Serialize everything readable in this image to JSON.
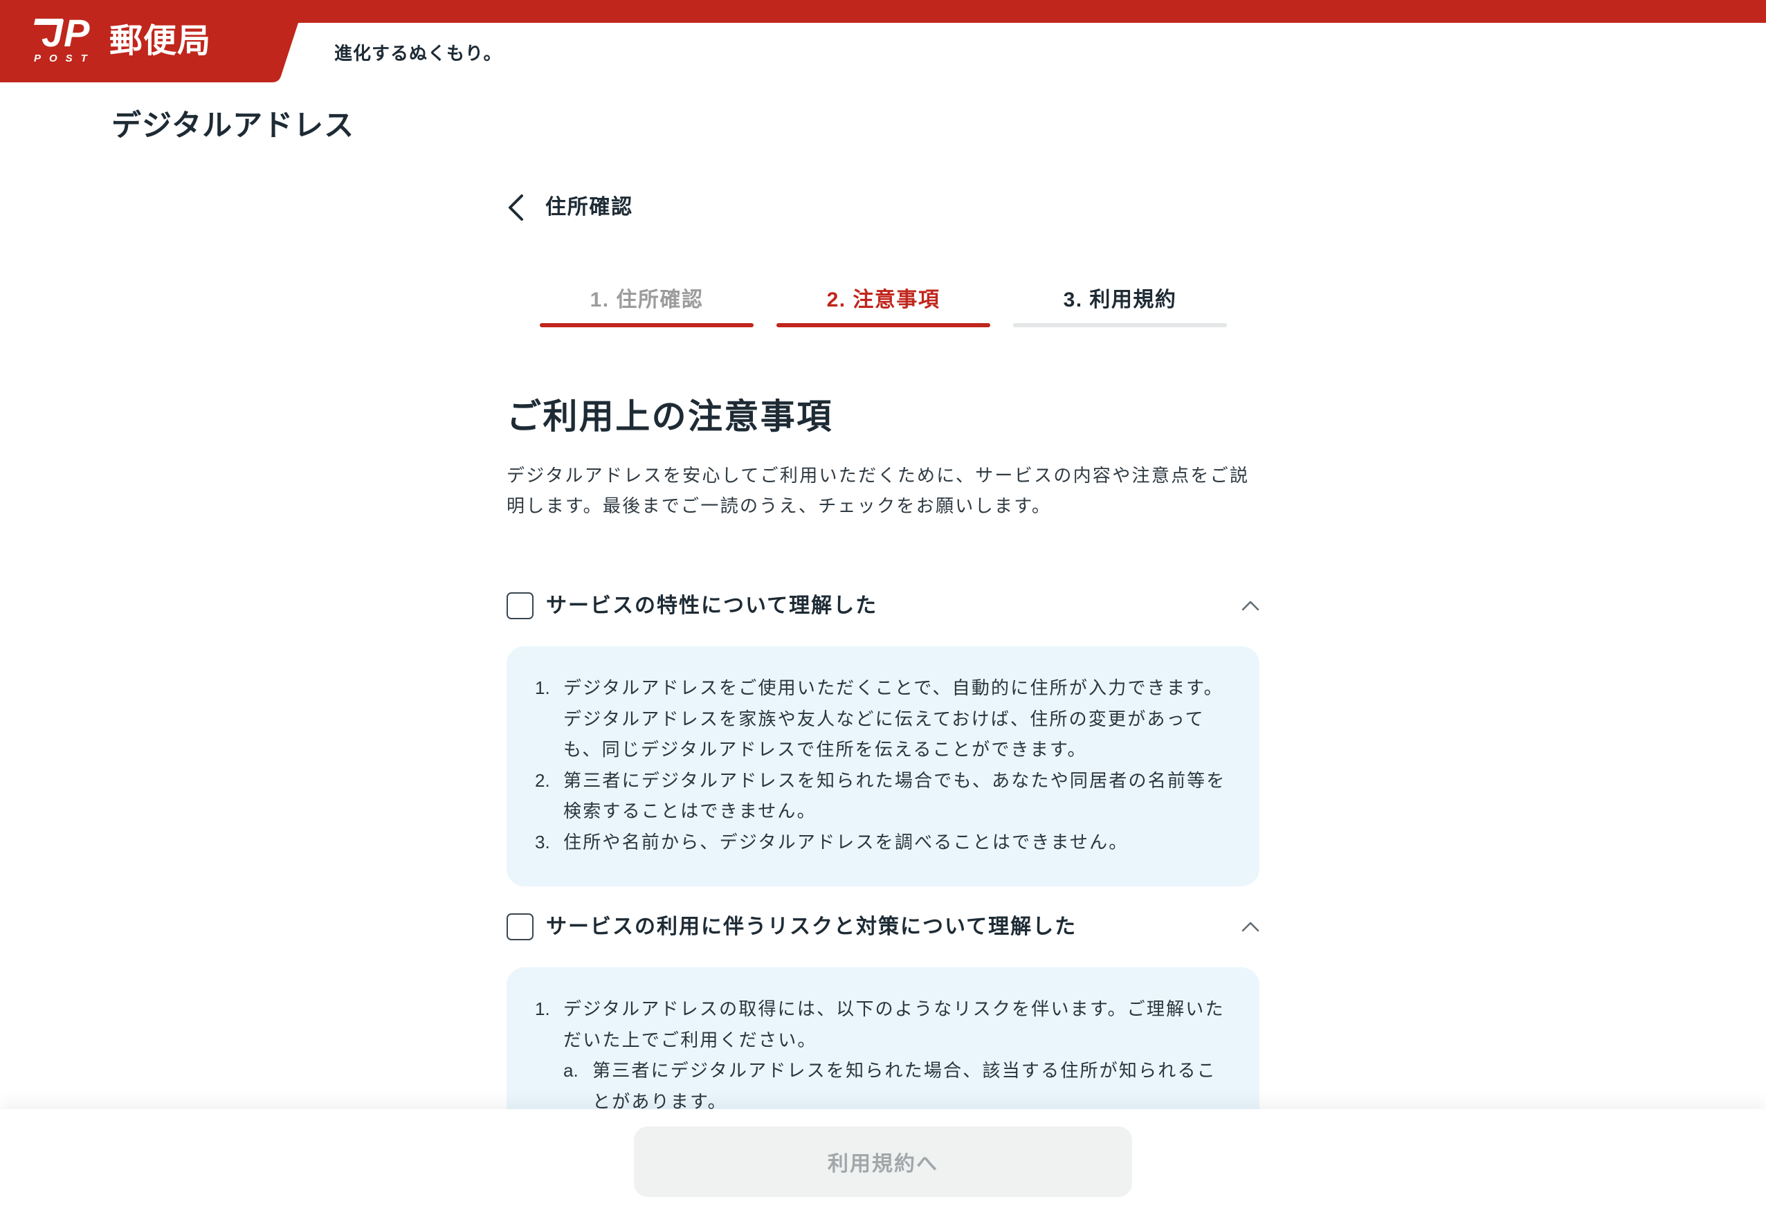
{
  "colors": {
    "brand_red": "#c0261c",
    "text_dark": "#1e2b35",
    "text_body": "#2f3a42",
    "text_muted": "#9c9c9c",
    "step_track": "#e4e6e7",
    "notice_bg": "#eaf6fc",
    "button_disabled_bg": "#f0f2f2",
    "button_disabled_text": "#a2a7aa"
  },
  "header": {
    "logo_mark": "JP",
    "logo_sub": "POST",
    "brand_name": "郵便局",
    "tagline": "進化するぬくもり。"
  },
  "page": {
    "service_title": "デジタルアドレス"
  },
  "back_nav": {
    "icon": "chevron-left-icon",
    "label": "住所確認"
  },
  "steps": [
    {
      "label": "1. 住所確認",
      "completed": true,
      "current": false
    },
    {
      "label": "2. 注意事項",
      "completed": false,
      "current": true
    },
    {
      "label": "3. 利用規約",
      "completed": false,
      "current": false
    }
  ],
  "main": {
    "heading": "ご利用上の注意事項",
    "intro": "デジタルアドレスを安心してご利用いただくために、サービスの内容や注意点をご説明します。最後までご一読のうえ、チェックをお願いします。",
    "sections": [
      {
        "checkbox_label": "サービスの特性について理解した",
        "checked": false,
        "expanded": true,
        "toggle_icon": "chevron-up-icon",
        "items": [
          {
            "number": "1.",
            "text": "デジタルアドレスをご使用いただくことで、自動的に住所が入力できます。デジタルアドレスを家族や友人などに伝えておけば、住所の変更があっても、同じデジタルアドレスで住所を伝えることができます。"
          },
          {
            "number": "2.",
            "text": "第三者にデジタルアドレスを知られた場合でも、あなたや同居者の名前等を検索することはできません。"
          },
          {
            "number": "3.",
            "text": "住所や名前から、デジタルアドレスを調べることはできません。"
          }
        ]
      },
      {
        "checkbox_label": "サービスの利用に伴うリスクと対策について理解した",
        "checked": false,
        "expanded": true,
        "toggle_icon": "chevron-up-icon",
        "items": [
          {
            "number": "1.",
            "text": "デジタルアドレスの取得には、以下のようなリスクを伴います。ご理解いただいた上でご利用ください。",
            "subitems": [
              {
                "marker": "a.",
                "text": "第三者にデジタルアドレスを知られた場合、該当する住所が知られることがあります。"
              }
            ]
          }
        ]
      }
    ]
  },
  "footer": {
    "next_button": {
      "label": "利用規約へ",
      "enabled": false
    }
  }
}
